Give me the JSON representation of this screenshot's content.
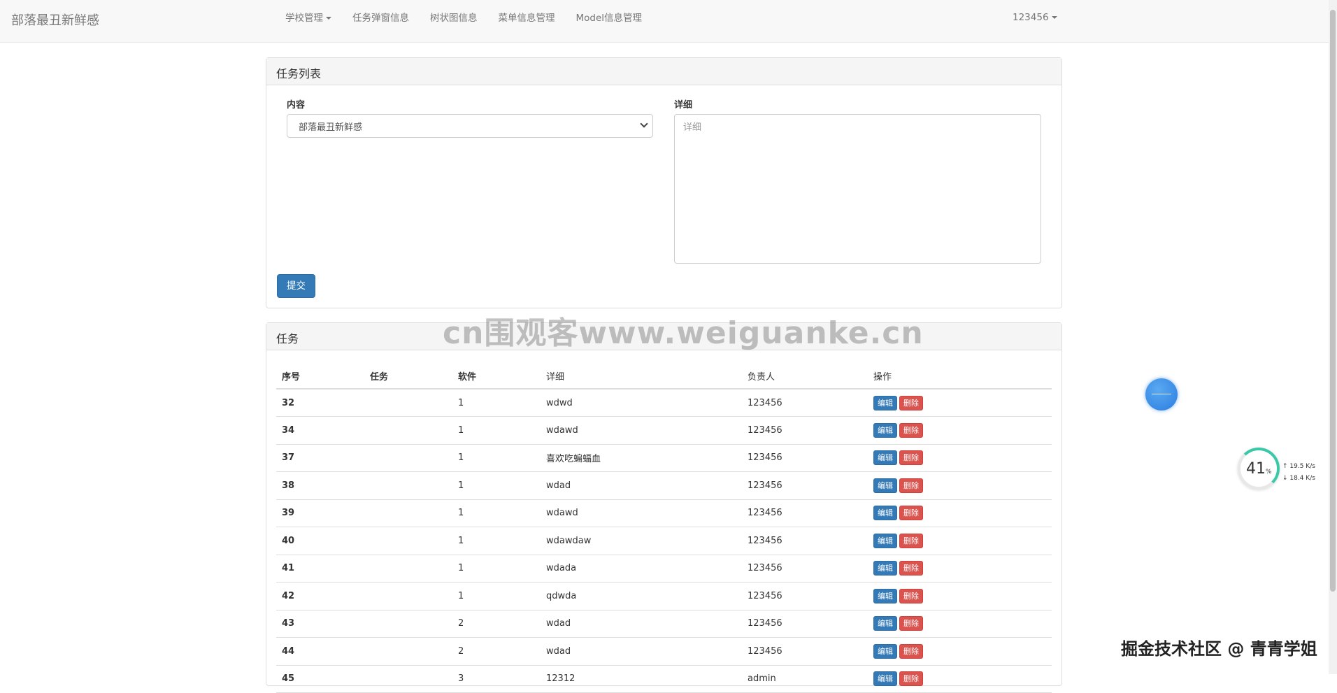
{
  "navbar": {
    "brand": "部落最丑新鲜感",
    "items": [
      {
        "label": "学校管理",
        "dropdown": true
      },
      {
        "label": "任务弹窗信息"
      },
      {
        "label": "树状图信息"
      },
      {
        "label": "菜单信息管理"
      },
      {
        "label": "Model信息管理"
      }
    ],
    "user": "123456"
  },
  "form_panel": {
    "title": "任务列表",
    "content_label": "内容",
    "content_value": "部落最丑新鲜感",
    "detail_label": "详细",
    "detail_placeholder": "详细",
    "submit_label": "提交"
  },
  "table_panel": {
    "title": "任务",
    "columns": [
      "序号",
      "任务",
      "软件",
      "详细",
      "负责人",
      "操作"
    ],
    "rows": [
      {
        "id": "32",
        "task": "",
        "software": "1",
        "detail": "wdwd",
        "owner": "123456"
      },
      {
        "id": "34",
        "task": "",
        "software": "1",
        "detail": "wdawd",
        "owner": "123456"
      },
      {
        "id": "37",
        "task": "",
        "software": "1",
        "detail": "喜欢吃蝙蝠血",
        "owner": "123456"
      },
      {
        "id": "38",
        "task": "",
        "software": "1",
        "detail": "wdad",
        "owner": "123456"
      },
      {
        "id": "39",
        "task": "",
        "software": "1",
        "detail": "wdawd",
        "owner": "123456"
      },
      {
        "id": "40",
        "task": "",
        "software": "1",
        "detail": "wdawdaw",
        "owner": "123456"
      },
      {
        "id": "41",
        "task": "",
        "software": "1",
        "detail": "wdada",
        "owner": "123456"
      },
      {
        "id": "42",
        "task": "",
        "software": "1",
        "detail": "qdwda",
        "owner": "123456"
      },
      {
        "id": "43",
        "task": "",
        "software": "2",
        "detail": "wdad",
        "owner": "123456"
      },
      {
        "id": "44",
        "task": "",
        "software": "2",
        "detail": "wdad",
        "owner": "123456"
      },
      {
        "id": "45",
        "task": "",
        "software": "3",
        "detail": "12312",
        "owner": "admin"
      }
    ],
    "edit_label": "编辑",
    "delete_label": "删除"
  },
  "watermark": "cn围观客www.weiguanke.cn",
  "corner_watermark": "掘金技术社区 @ 青青学姐",
  "speed_widget": {
    "percent": "41",
    "percent_unit": "%",
    "up": "19.5 K/s",
    "down": "18.4 K/s"
  },
  "colors": {
    "primary": "#337ab7",
    "danger": "#d9534f",
    "navbar_bg": "#f8f8f8"
  }
}
